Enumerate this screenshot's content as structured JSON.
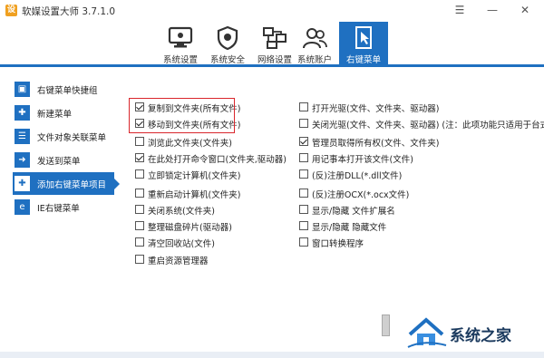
{
  "window": {
    "title": "软媒设置大师 3.7.1.0",
    "logo_char": "设",
    "menu_icon": "menu-icon",
    "min_icon": "minimize-icon",
    "close_icon": "close-icon"
  },
  "toolbar": {
    "items": [
      {
        "label": "系统设置",
        "icon": "monitor-settings-icon",
        "active": false
      },
      {
        "label": "系统安全",
        "icon": "shield-icon",
        "active": false
      },
      {
        "label": "网络设置",
        "icon": "network-icon",
        "active": false
      },
      {
        "label": "系统账户",
        "icon": "users-icon",
        "active": false
      },
      {
        "label": "右键菜单",
        "icon": "mouse-pointer-icon",
        "active": true
      }
    ],
    "accent_color": "#1f70c1"
  },
  "sidebar": {
    "items": [
      {
        "label": "右键菜单快捷组",
        "icon": "group-icon",
        "icon_char": "▣",
        "active": false
      },
      {
        "label": "新建菜单",
        "icon": "new-menu-icon",
        "icon_char": "✚",
        "active": false
      },
      {
        "label": "文件对象关联菜单",
        "icon": "file-menu-icon",
        "icon_char": "☰",
        "active": false
      },
      {
        "label": "发送到菜单",
        "icon": "send-to-icon",
        "icon_char": "➜",
        "active": false
      },
      {
        "label": "添加右键菜单项目",
        "icon": "add-item-icon",
        "icon_char": "✚",
        "active": true
      },
      {
        "label": "IE右键菜单",
        "icon": "ie-icon",
        "icon_char": "e",
        "active": false
      }
    ]
  },
  "options": {
    "left": [
      {
        "label": "复制到文件夹(所有文件)",
        "checked": true
      },
      {
        "label": "移动到文件夹(所有文件)",
        "checked": true
      },
      {
        "label": "浏览此文件夹(文件夹)",
        "checked": false
      },
      {
        "label": "在此处打开命令窗口(文件夹,驱动器)",
        "checked": true
      },
      {
        "label": "立即锁定计算机(文件夹)",
        "checked": false
      },
      {
        "label": "重新启动计算机(文件夹)",
        "checked": false
      },
      {
        "label": "关闭系统(文件夹)",
        "checked": false
      },
      {
        "label": "整理磁盘碎片(驱动器)",
        "checked": false
      },
      {
        "label": "清空回收站(文件)",
        "checked": false
      },
      {
        "label": "重启资源管理器",
        "checked": false
      }
    ],
    "right": [
      {
        "label": "打开光驱(文件、文件夹、驱动器)",
        "checked": false
      },
      {
        "label": "关闭光驱(文件、文件夹、驱动器) (注：此项功能只适用于台式机)",
        "checked": false
      },
      {
        "label": "管理员取得所有权(文件、文件夹)",
        "checked": true
      },
      {
        "label": "用记事本打开该文件(文件)",
        "checked": false
      },
      {
        "label": "(反)注册DLL(*.dll文件)",
        "checked": false
      },
      {
        "label": "(反)注册OCX(*.ocx文件)",
        "checked": false
      },
      {
        "label": "显示/隐藏 文件扩展名",
        "checked": false
      },
      {
        "label": "显示/隐藏 隐藏文件",
        "checked": false
      },
      {
        "label": "窗口转换程序",
        "checked": false
      }
    ]
  },
  "watermark": {
    "text": "系统之家",
    "icon": "house-logo-icon"
  }
}
